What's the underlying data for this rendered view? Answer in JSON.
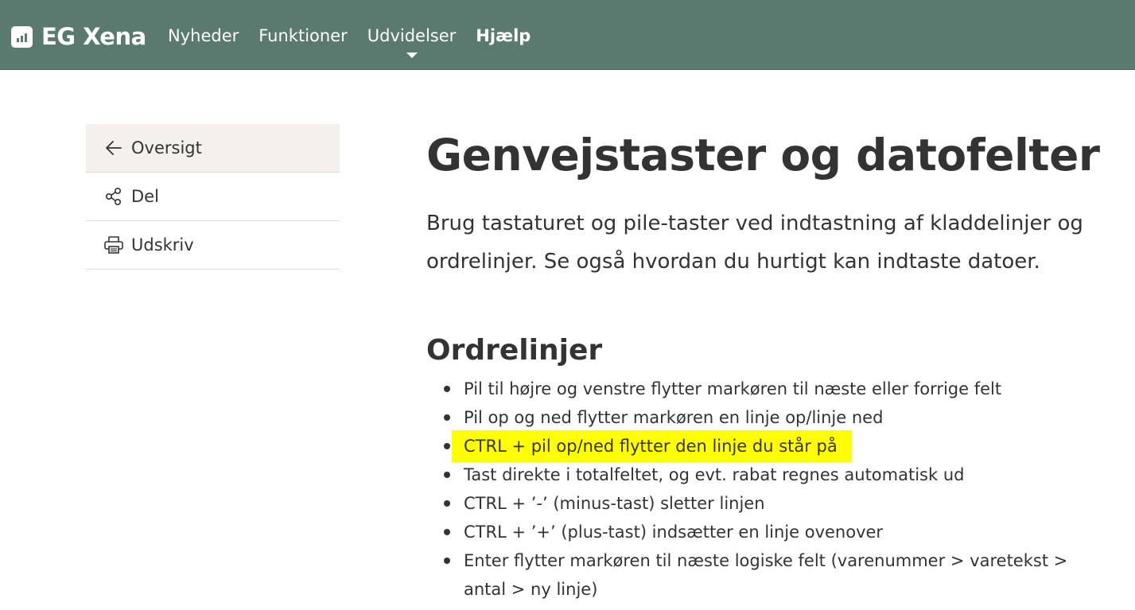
{
  "header": {
    "logo_text": "EG Xena",
    "nav": [
      {
        "label": "Nyheder"
      },
      {
        "label": "Funktioner"
      },
      {
        "label": "Udvidelser"
      },
      {
        "label": "Hjælp"
      }
    ]
  },
  "sidebar": {
    "items": [
      {
        "label": "Oversigt",
        "icon": "arrow-left-icon"
      },
      {
        "label": "Del",
        "icon": "share-icon"
      },
      {
        "label": "Udskriv",
        "icon": "printer-icon"
      }
    ]
  },
  "main": {
    "title": "Genvejstaster og datofelter",
    "lead": "Brug tastaturet og pile-taster ved indtastning af kladdelinjer og ordrelinjer. Se også hvordan du hurtigt kan indtaste datoer.",
    "section_title": "Ordrelinjer",
    "bullets": [
      "Pil til højre og venstre flytter markøren til næste eller forrige felt",
      "Pil op og ned flytter markøren en linje op/linje ned",
      "CTRL + pil op/ned flytter den linje du står på",
      "Tast direkte i totalfeltet, og evt. rabat regnes automatisk ud",
      "CTRL + ’-’ (minus-tast) sletter linjen",
      "CTRL + ’+’ (plus-tast) indsætter en linje ovenover",
      "Enter flytter markøren til næste logiske felt (varenummer > varetekst > antal > ny linje)"
    ]
  },
  "colors": {
    "header_bg": "#5a7a70",
    "highlight": "#ffff00",
    "active_side_bg": "#f4f1ed"
  }
}
